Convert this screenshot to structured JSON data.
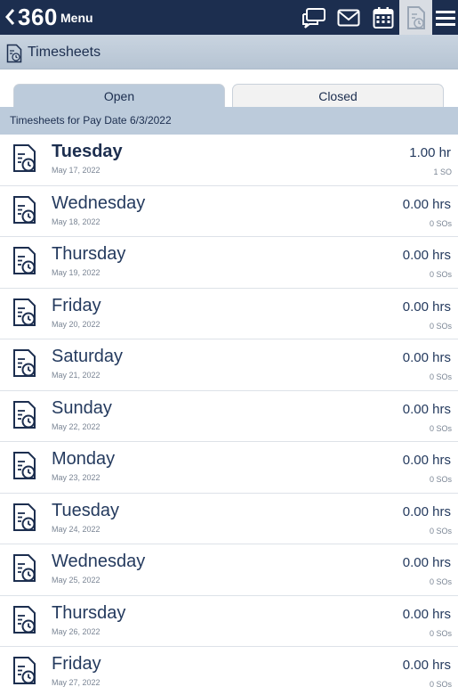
{
  "topbar": {
    "brand": "360",
    "menu_label": "Menu",
    "icons": [
      "back-chevron-icon",
      "chat-icon",
      "mail-icon",
      "calendar-icon",
      "timesheet-icon",
      "hamburger-menu-icon"
    ],
    "background": "#1c2e4f"
  },
  "titlebar": {
    "title": "Timesheets"
  },
  "tabs": [
    {
      "label": "Open",
      "active": true
    },
    {
      "label": "Closed",
      "active": false
    }
  ],
  "pay_date_header": "Timesheets for Pay Date 6/3/2022",
  "timesheets": [
    {
      "day": "Tuesday",
      "date": "May 17, 2022",
      "hours": "1.00 hr",
      "sos": "1 SO",
      "bold": true
    },
    {
      "day": "Wednesday",
      "date": "May 18, 2022",
      "hours": "0.00 hrs",
      "sos": "0 SOs"
    },
    {
      "day": "Thursday",
      "date": "May 19, 2022",
      "hours": "0.00 hrs",
      "sos": "0 SOs"
    },
    {
      "day": "Friday",
      "date": "May 20, 2022",
      "hours": "0.00 hrs",
      "sos": "0 SOs"
    },
    {
      "day": "Saturday",
      "date": "May 21, 2022",
      "hours": "0.00 hrs",
      "sos": "0 SOs"
    },
    {
      "day": "Sunday",
      "date": "May 22, 2022",
      "hours": "0.00 hrs",
      "sos": "0 SOs"
    },
    {
      "day": "Monday",
      "date": "May 23, 2022",
      "hours": "0.00 hrs",
      "sos": "0 SOs"
    },
    {
      "day": "Tuesday",
      "date": "May 24, 2022",
      "hours": "0.00 hrs",
      "sos": "0 SOs"
    },
    {
      "day": "Wednesday",
      "date": "May 25, 2022",
      "hours": "0.00 hrs",
      "sos": "0 SOs"
    },
    {
      "day": "Thursday",
      "date": "May 26, 2022",
      "hours": "0.00 hrs",
      "sos": "0 SOs"
    },
    {
      "day": "Friday",
      "date": "May 27, 2022",
      "hours": "0.00 hrs",
      "sos": "0 SOs"
    }
  ]
}
